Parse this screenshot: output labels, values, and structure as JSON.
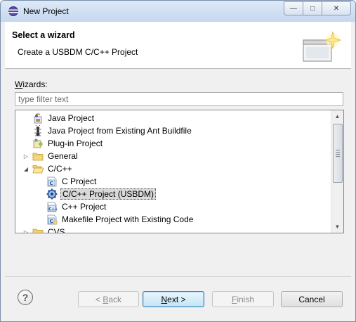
{
  "window": {
    "title": "New Project",
    "controls": {
      "minimize": "—",
      "maximize": "□",
      "close": "✕"
    }
  },
  "header": {
    "title": "Select a wizard",
    "description": "Create a USBDM C/C++ Project"
  },
  "wizards": {
    "label_prefix": "W",
    "label_rest": "izards:",
    "filter_placeholder": "type filter text",
    "filter_value": ""
  },
  "tree": {
    "items": [
      {
        "label": "Java Project",
        "level": 1,
        "expander": "",
        "icon": "java-project-icon"
      },
      {
        "label": "Java Project from Existing Ant Buildfile",
        "level": 1,
        "expander": "",
        "icon": "ant-buildfile-icon"
      },
      {
        "label": "Plug-in Project",
        "level": 1,
        "expander": "",
        "icon": "plugin-project-icon"
      },
      {
        "label": "General",
        "level": 1,
        "expander": "▷",
        "icon": "folder-icon"
      },
      {
        "label": "C/C++",
        "level": 1,
        "expander": "◢",
        "icon": "folder-open-icon"
      },
      {
        "label": "C Project",
        "level": 2,
        "expander": "",
        "icon": "c-project-icon"
      },
      {
        "label": "C/C++ Project (USBDM)",
        "level": 2,
        "expander": "",
        "icon": "usbdm-gear-icon",
        "selected": true
      },
      {
        "label": "C++ Project",
        "level": 2,
        "expander": "",
        "icon": "cpp-project-icon"
      },
      {
        "label": "Makefile Project with Existing Code",
        "level": 2,
        "expander": "",
        "icon": "makefile-project-icon"
      },
      {
        "label": "CVS",
        "level": 1,
        "expander": "▷",
        "icon": "folder-icon"
      }
    ]
  },
  "buttons": {
    "back_prefix": "< ",
    "back_mnemonic": "B",
    "back_rest": "ack",
    "next_mnemonic": "N",
    "next_rest": "ext >",
    "finish_mnemonic": "F",
    "finish_rest": "inish",
    "cancel": "Cancel",
    "help": "?"
  },
  "colors": {
    "selection": "#d9d9d9",
    "default_button_border": "#3c7fb1",
    "folder": "#e8c25e"
  }
}
